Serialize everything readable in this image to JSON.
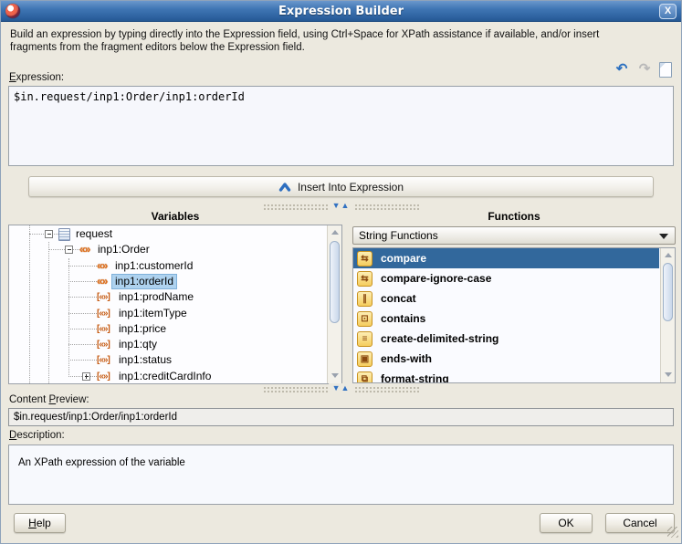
{
  "window": {
    "title": "Expression Builder",
    "close_glyph": "X"
  },
  "intro": {
    "line1": "Build an expression by typing directly into the Expression field, using Ctrl+Space for XPath assistance if available, and/or insert",
    "line2": "fragments from the fragment editors below the Expression field."
  },
  "expression": {
    "label": "Expression:",
    "value": "$in.request/inp1:Order/inp1:orderId",
    "undo_glyph": "↶",
    "redo_glyph": "↷"
  },
  "insert_button": {
    "label": "Insert Into Expression"
  },
  "variables": {
    "header": "Variables",
    "tree": [
      {
        "label": "request",
        "depth": 0,
        "icon": "variable",
        "expander": "minus",
        "selected": false
      },
      {
        "label": "inp1:Order",
        "depth": 1,
        "icon": "element",
        "expander": "minus",
        "selected": false
      },
      {
        "label": "inp1:customerId",
        "depth": 2,
        "icon": "element",
        "expander": "",
        "selected": false
      },
      {
        "label": "inp1:orderId",
        "depth": 2,
        "icon": "element",
        "expander": "",
        "selected": true
      },
      {
        "label": "inp1:prodName",
        "depth": 2,
        "icon": "attribute",
        "expander": "",
        "selected": false
      },
      {
        "label": "inp1:itemType",
        "depth": 2,
        "icon": "attribute",
        "expander": "",
        "selected": false
      },
      {
        "label": "inp1:price",
        "depth": 2,
        "icon": "attribute",
        "expander": "",
        "selected": false
      },
      {
        "label": "inp1:qty",
        "depth": 2,
        "icon": "attribute",
        "expander": "",
        "selected": false
      },
      {
        "label": "inp1:status",
        "depth": 2,
        "icon": "attribute",
        "expander": "",
        "selected": false
      },
      {
        "label": "inp1:creditCardInfo",
        "depth": 2,
        "icon": "attribute",
        "expander": "plus",
        "selected": false
      }
    ],
    "icon_glyphs": {
      "element": "«»",
      "attribute": "[«»]"
    }
  },
  "functions": {
    "header": "Functions",
    "category": "String Functions",
    "items": [
      {
        "label": "compare",
        "glyph": "⇆",
        "selected": true
      },
      {
        "label": "compare-ignore-case",
        "glyph": "⇆",
        "selected": false
      },
      {
        "label": "concat",
        "glyph": "∥",
        "selected": false
      },
      {
        "label": "contains",
        "glyph": "⊡",
        "selected": false
      },
      {
        "label": "create-delimited-string",
        "glyph": "≡",
        "selected": false
      },
      {
        "label": "ends-with",
        "glyph": "▣",
        "selected": false
      },
      {
        "label": "format-string",
        "glyph": "⧉",
        "selected": false
      }
    ]
  },
  "content_preview": {
    "label": "Content Preview:",
    "value": "$in.request/inp1:Order/inp1:orderId"
  },
  "description": {
    "label": "Description:",
    "value": "An XPath expression of the variable"
  },
  "buttons": {
    "help": "Help",
    "ok": "OK",
    "cancel": "Cancel"
  },
  "colors": {
    "titlebar_blue": "#3c74b2",
    "list_selection": "#32689c",
    "tree_selection": "#aed2ef",
    "accent_blue": "#2e6fc0",
    "function_icon_gold": "#f5cd5e",
    "dialog_background": "#ece9df"
  }
}
